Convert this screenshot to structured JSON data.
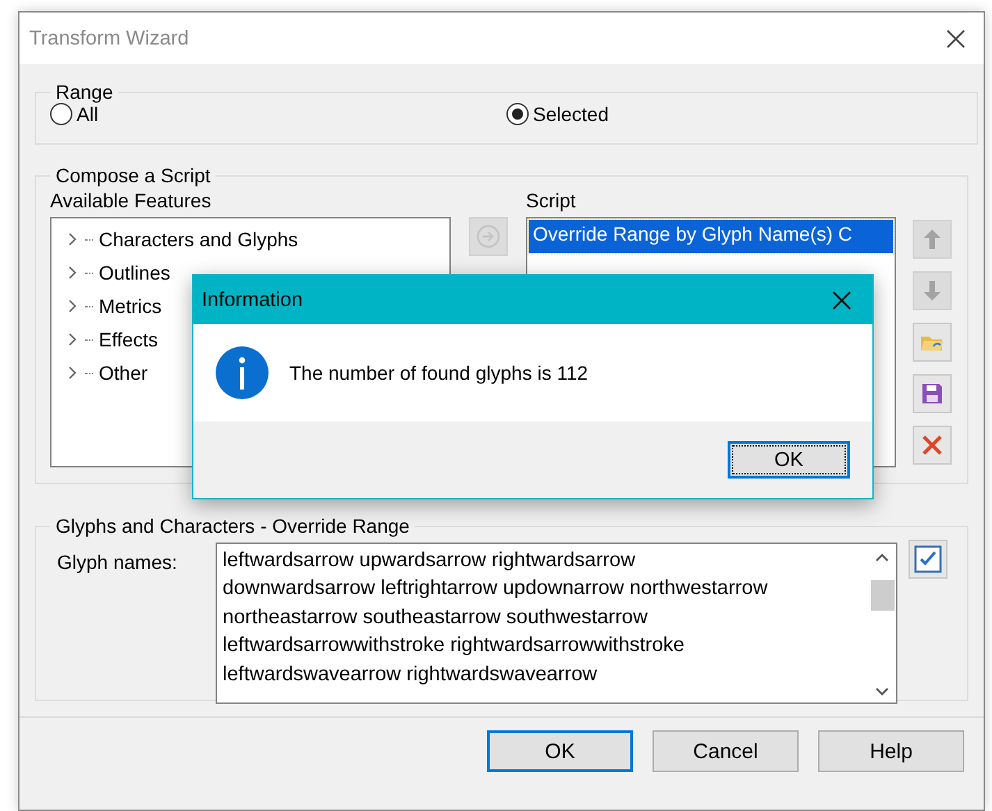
{
  "window": {
    "title": "Transform Wizard"
  },
  "range": {
    "title": "Range",
    "options": [
      {
        "label": "All",
        "selected": false
      },
      {
        "label": "Selected",
        "selected": true
      }
    ]
  },
  "compose": {
    "title": "Compose a Script",
    "features_label": "Available Features",
    "features": [
      {
        "label": "Characters and Glyphs",
        "expanded": false
      },
      {
        "label": "Outlines",
        "expanded": false
      },
      {
        "label": "Metrics",
        "expanded": false
      },
      {
        "label": "Effects",
        "expanded": false
      },
      {
        "label": "Other",
        "expanded": false
      }
    ],
    "script_label": "Script",
    "script_items": [
      {
        "label": "Override Range by Glyph Name(s) C",
        "selected": true
      }
    ],
    "add_button": {
      "disabled": true
    },
    "side_buttons": [
      {
        "kind": "up",
        "disabled": true
      },
      {
        "kind": "down",
        "disabled": true
      },
      {
        "kind": "open",
        "disabled": false
      },
      {
        "kind": "save",
        "disabled": false
      },
      {
        "kind": "delete",
        "disabled": false
      }
    ]
  },
  "override": {
    "title": "Glyphs and Characters - Override Range",
    "field_label": "Glyph names:",
    "lines": [
      "leftwardsarrow upwardsarrow rightwardsarrow",
      "downwardsarrow leftrightarrow updownarrow northwestarrow",
      "northeastarrow southeastarrow southwestarrow",
      "leftwardsarrowwithstroke rightwardsarrowwithstroke",
      "leftwardswavearrow rightwardswavearrow"
    ],
    "check": {
      "checked": true
    }
  },
  "buttons": [
    {
      "label": "OK",
      "default": true
    },
    {
      "label": "Cancel",
      "default": false
    },
    {
      "label": "Help",
      "default": false
    }
  ],
  "dialog": {
    "title": "Information",
    "message": "The number of found glyphs is 112",
    "button": "OK"
  }
}
